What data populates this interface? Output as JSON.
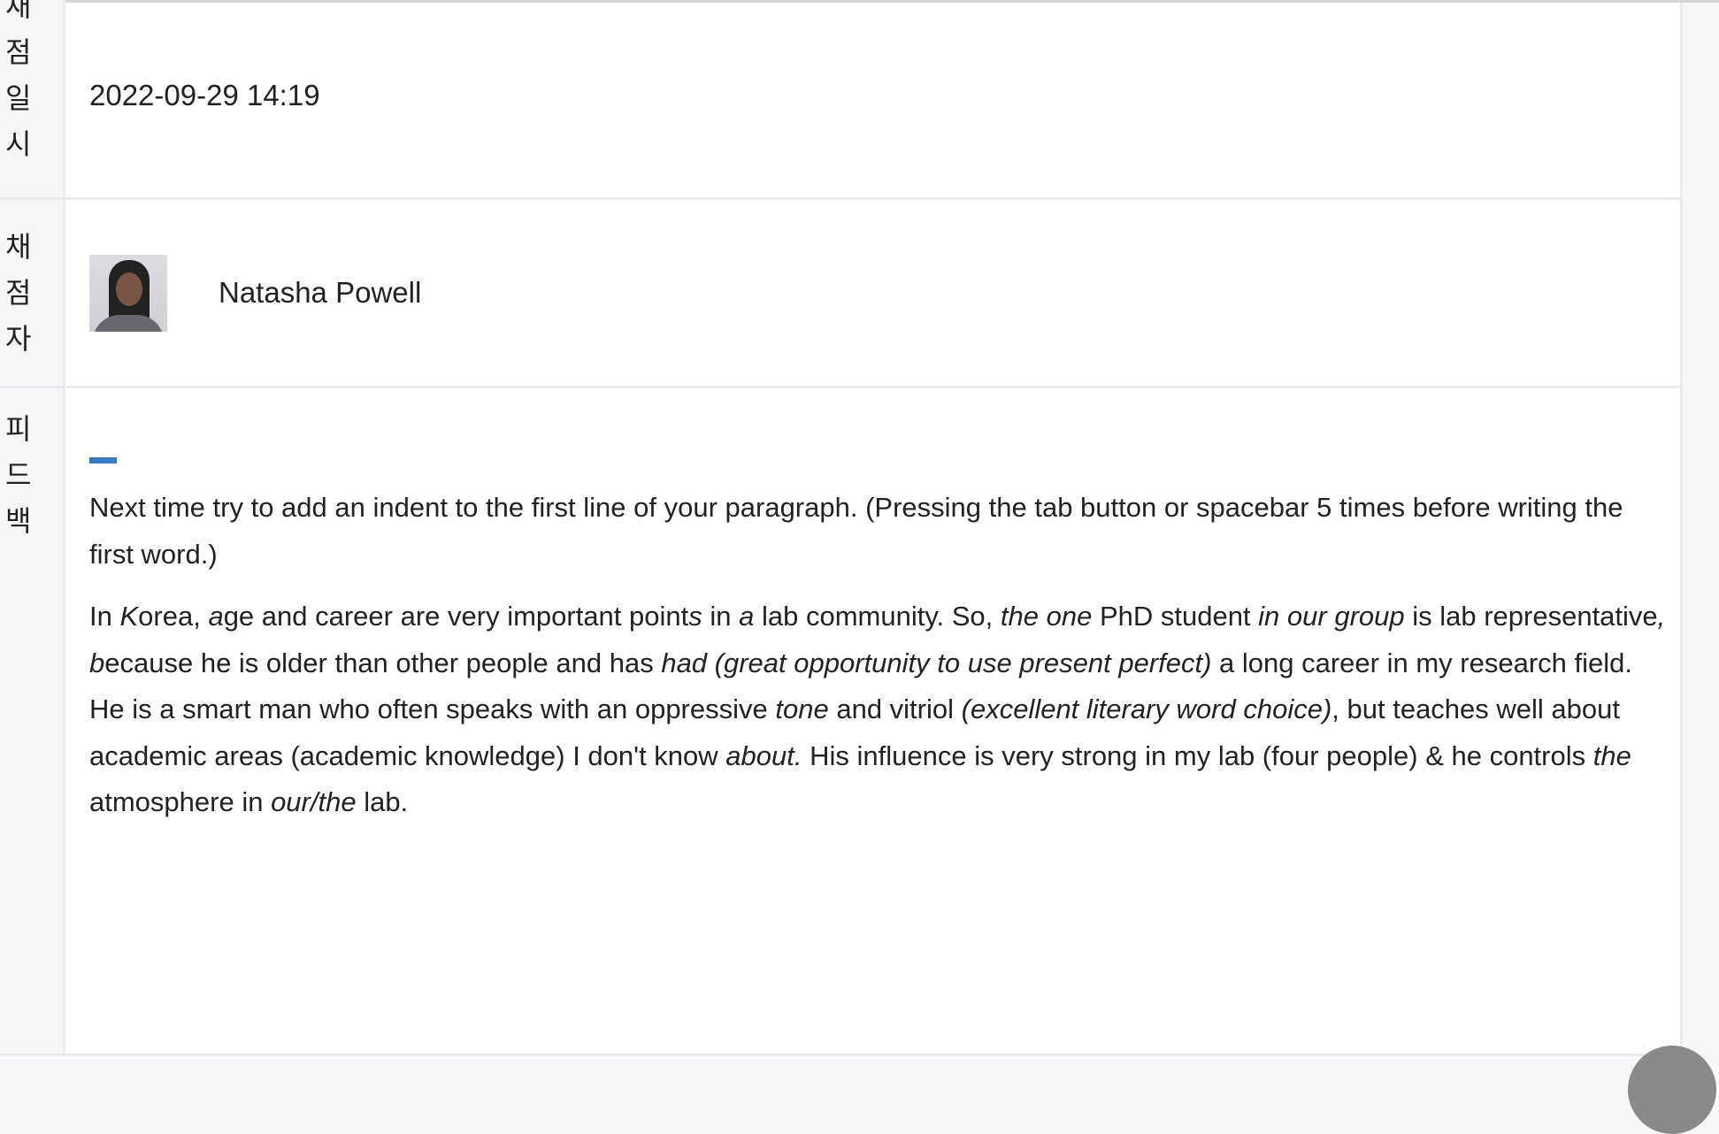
{
  "rows": {
    "graded_at": {
      "label_chars": [
        "재",
        "점",
        "일",
        "시"
      ],
      "value": "2022-09-29 14:19"
    },
    "grader": {
      "label_chars": [
        "채",
        "점",
        "자"
      ],
      "name": "Natasha Powell",
      "avatar_icon": "person-photo"
    },
    "feedback": {
      "label_chars": [
        "피",
        "드",
        "백"
      ],
      "accent_color": "#3a7bc8",
      "paragraphs": [
        [
          {
            "text": "Next time try to add an indent to the first line of your paragraph. (Pressing the tab button or spacebar 5 times before writing the first word.)",
            "italic": false
          }
        ],
        [
          {
            "text": "In ",
            "italic": false
          },
          {
            "text": "K",
            "italic": true
          },
          {
            "text": "orea, ",
            "italic": false
          },
          {
            "text": "a",
            "italic": true
          },
          {
            "text": "ge and career are very important point",
            "italic": false
          },
          {
            "text": "s",
            "italic": true
          },
          {
            "text": " in ",
            "italic": false
          },
          {
            "text": "a",
            "italic": true
          },
          {
            "text": " lab community. So, ",
            "italic": false
          },
          {
            "text": "the one",
            "italic": true
          },
          {
            "text": " PhD student ",
            "italic": false
          },
          {
            "text": "in our group",
            "italic": true
          },
          {
            "text": " is lab representative",
            "italic": false
          },
          {
            "text": ", b",
            "italic": true
          },
          {
            "text": "ecause he is older than other people and has ",
            "italic": false
          },
          {
            "text": "had  (great opportunity to use present perfect)",
            "italic": true
          },
          {
            "text": " a long career in my research field. He is a smart man who often speaks with an oppressive ",
            "italic": false
          },
          {
            "text": "tone",
            "italic": true
          },
          {
            "text": " and vitriol ",
            "italic": false
          },
          {
            "text": "(excellent literary word choice)",
            "italic": true
          },
          {
            "text": ", but teaches well about academic areas (academic knowledge) I don't know ",
            "italic": false
          },
          {
            "text": "about.",
            "italic": true
          },
          {
            "text": " His influence is very strong in my lab (four people) & he controls ",
            "italic": false
          },
          {
            "text": "the",
            "italic": true
          },
          {
            "text": " atmosphere in ",
            "italic": false
          },
          {
            "text": "our/the",
            "italic": true
          },
          {
            "text": " lab.",
            "italic": false
          }
        ]
      ]
    }
  }
}
